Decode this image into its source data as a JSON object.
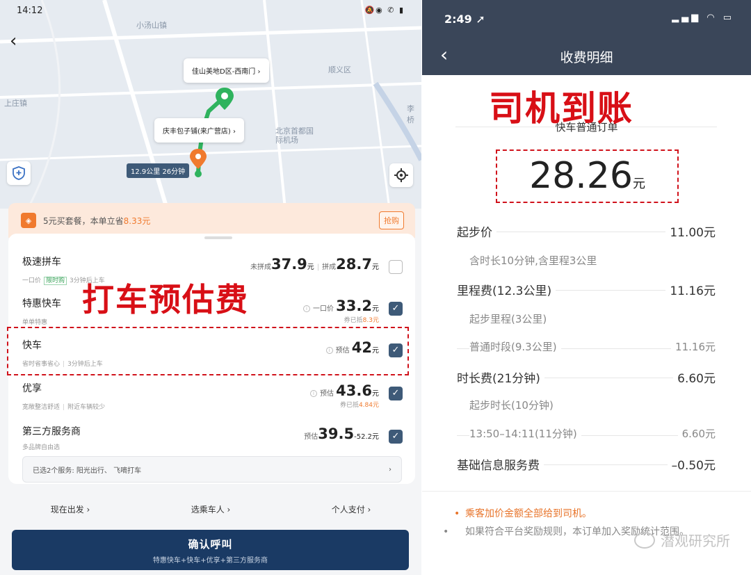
{
  "left": {
    "status_time": "14:12",
    "status_icons": "🔕◉ ✆ ▮",
    "back_icon": "‹",
    "map_labels": [
      "小汤山镇",
      "顺义区",
      "上庄镇",
      "北京首都国际机场",
      "李桥"
    ],
    "pickup_tip": "佳山美地D区-西南门",
    "dest_tip": "庆丰包子铺(来广营店)",
    "tip_arrow": "›",
    "distance_tag": "12.9公里 26分钟",
    "promo_text": "5元买套餐，本单立省",
    "promo_amount": "8.33元",
    "promo_button": "抢购",
    "rides": [
      {
        "name": "极速拼车",
        "sub_pre": "一口价",
        "sub_tag": "限时购",
        "sub_post": "3分钟后上车",
        "price_label1": "未拼成",
        "price1": "37.9",
        "price_label2": "拼成",
        "price2": "28.7",
        "unit": "元",
        "saved": "",
        "checked": false
      },
      {
        "name": "特惠快车",
        "sub_pre": "单单特惠",
        "sub_tag": "",
        "sub_post": "",
        "price_label1": "一口价",
        "price1": "33.2",
        "price_label2": "",
        "price2": "",
        "unit": "元",
        "saved_pre": "券已抵",
        "saved_amt": "8.3元",
        "checked": true
      },
      {
        "name": "快车",
        "sub_pre": "省时省事省心",
        "sub_tag": "",
        "sub_post": "3分钟后上车",
        "price_label1": "预估",
        "price1": "42",
        "price_label2": "",
        "price2": "",
        "unit": "元",
        "saved": "",
        "checked": true
      },
      {
        "name": "优享",
        "sub_pre": "宽敞整洁舒适",
        "sub_tag": "",
        "sub_post": "附近车辆较少",
        "price_label1": "预估",
        "price1": "43.6",
        "price_label2": "",
        "price2": "",
        "unit": "元",
        "saved_pre": "券已抵",
        "saved_amt": "4.84元",
        "checked": true
      },
      {
        "name": "第三方服务商",
        "sub_pre": "多品牌自由选",
        "sub_tag": "",
        "sub_post": "",
        "price_label1": "预估",
        "price1": "39.5",
        "price_range_tail": "-52.2",
        "unit": "元",
        "saved": "",
        "checked": true
      }
    ],
    "third_box_text": "已选2个服务:   阳光出行、   飞嘀打车",
    "third_box_arrow": "›",
    "overlay": "打车预估费",
    "options": [
      "现在出发 ›",
      "选乘车人 ›",
      "个人支付 ›"
    ],
    "confirm_title": "确认呼叫",
    "confirm_sub": "特惠快车+快车+优享+第三方服务商",
    "checkmark": "✓"
  },
  "right": {
    "status_time": "2:49 ➚",
    "status_icons": "▂▄▆ ◠ ▭",
    "back_icon": "‹",
    "title": "收费明细",
    "overlay": "司机到账",
    "order_type": "快车普通订单",
    "amount": "28.26",
    "amount_unit": "元",
    "fees": [
      {
        "label": "起步价",
        "value": "11.00元",
        "kind": "main"
      },
      {
        "label": "含时长10分钟,含里程3公里",
        "value": "",
        "kind": "sub"
      },
      {
        "label": "里程费(12.3公里)",
        "value": "11.16元",
        "kind": "main"
      },
      {
        "label": "起步里程(3公里)",
        "value": "",
        "kind": "sub"
      },
      {
        "label": "普通时段(9.3公里)",
        "value": "11.16元",
        "kind": "sub"
      },
      {
        "label": "时长费(21分钟)",
        "value": "6.60元",
        "kind": "main"
      },
      {
        "label": "起步时长(10分钟)",
        "value": "",
        "kind": "sub"
      },
      {
        "label": "13:50–14:11(11分钟)",
        "value": "6.60元",
        "kind": "sub"
      },
      {
        "label": "基础信息服务费",
        "value": "–0.50元",
        "kind": "main"
      }
    ],
    "notes": [
      {
        "text": "乘客加价金额全部给到司机。",
        "color": "orange"
      },
      {
        "text": "如果符合平台奖励规则，本订单加入奖励统计范围。",
        "color": "grey"
      }
    ],
    "bullet": "•",
    "watermark": "潜观研究所"
  }
}
